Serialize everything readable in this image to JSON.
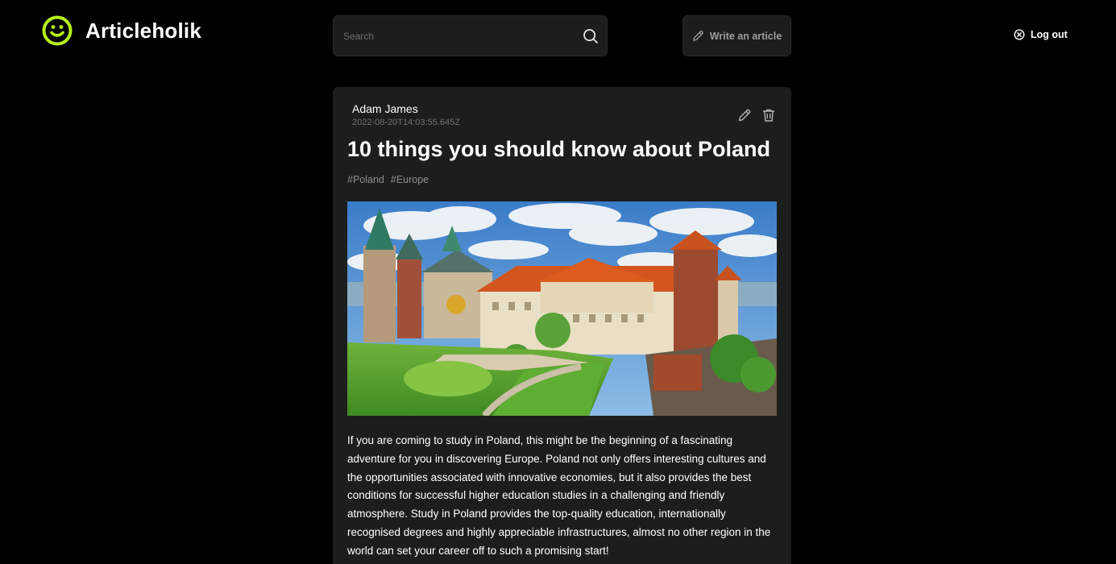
{
  "app": {
    "name": "Articleholik",
    "accent": "#b6f01a",
    "logo_icon": "smiley-face-icon"
  },
  "header": {
    "search": {
      "placeholder": "Search",
      "value": "",
      "icon": "search-icon"
    },
    "write_button": {
      "label": "Write an article",
      "icon": "pencil-icon"
    },
    "logout_button": {
      "label": "Log out",
      "icon": "circle-x-icon"
    }
  },
  "article": {
    "author": "Adam James",
    "date": "2022-08-20T14:03:55.645Z",
    "title": "10 things you should know about Poland",
    "tags": [
      "#Poland",
      "#Europe"
    ],
    "actions": {
      "edit_icon": "pencil-icon",
      "delete_icon": "trash-icon"
    },
    "image": {
      "subject": "Wawel Castle, Kraków"
    },
    "body": "If you are coming to study in Poland, this might be the beginning of a fascinating adventure for you in discovering Europe. Poland not only offers interesting cultures and the opportunities associated with innovative economies, but it also provides the best conditions for successful higher education studies in a challenging and friendly atmosphere. Study in Poland provides the top-quality education, internationally recognised degrees and highly appreciable infrastructures, almost no other region in the world can set your career off to such a promising start!"
  },
  "colors": {
    "background": "#000000",
    "surface": "#1c1e1e",
    "muted_text": "#8d9090"
  }
}
